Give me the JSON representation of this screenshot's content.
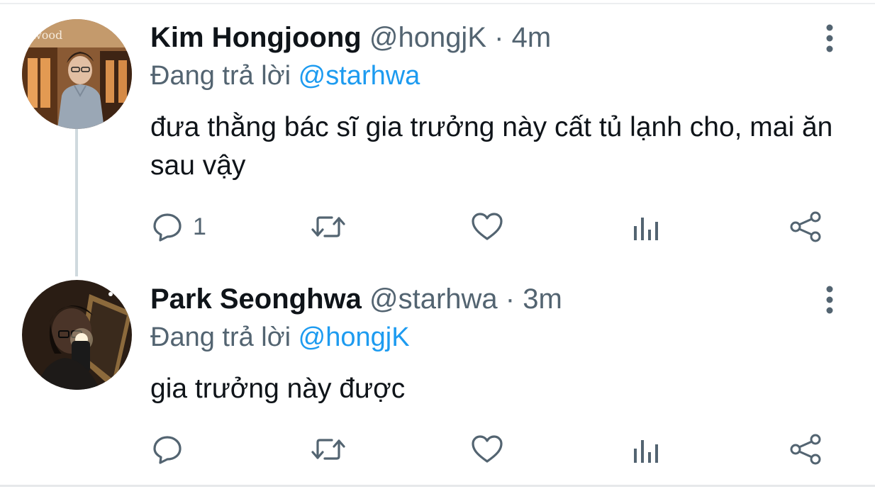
{
  "tweets": [
    {
      "display_name": "Kim Hongjoong",
      "handle": "@hongjK",
      "separator": "·",
      "time": "4m",
      "reply_prefix": "Đang trả lời",
      "reply_to": "@starhwa",
      "text": "đưa thằng bác sĩ gia trưởng này cất tủ lạnh cho, mai ăn sau vậy",
      "reply_count": "1",
      "avatar_logo_text": "wood"
    },
    {
      "display_name": "Park Seonghwa",
      "handle": "@starhwa",
      "separator": "·",
      "time": "3m",
      "reply_prefix": "Đang trả lời",
      "reply_to": "@hongjK",
      "text": "gia trưởng này được",
      "reply_count": ""
    }
  ],
  "icons": {
    "reply": "reply-icon",
    "retweet": "retweet-icon",
    "like": "heart-icon",
    "analytics": "analytics-icon",
    "share": "share-icon",
    "more": "more-vertical-icon"
  },
  "colors": {
    "text": "#0f1419",
    "secondary": "#536471",
    "mention": "#1d9bf0",
    "thread_line": "#cfd9de"
  }
}
